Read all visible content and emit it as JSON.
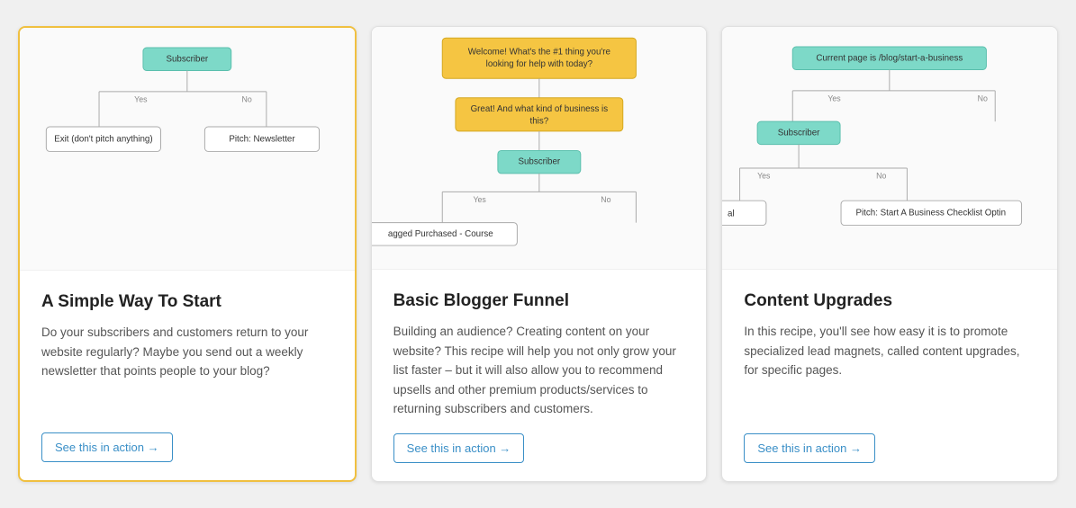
{
  "cards": [
    {
      "id": "card-1",
      "selected": true,
      "title": "A Simple Way To Start",
      "description": "Do your subscribers and customers return to your website regularly? Maybe you send out a weekly newsletter that points people to your blog?",
      "button_label": "See this in action →",
      "diagram_type": "simple_start"
    },
    {
      "id": "card-2",
      "selected": false,
      "title": "Basic Blogger Funnel",
      "description": "Building an audience? Creating content on your website? This recipe will help you not only grow your list faster – but it will also allow you to recommend upsells and other premium products/services to returning subscribers and customers.",
      "button_label": "See this in action →",
      "diagram_type": "blogger_funnel"
    },
    {
      "id": "card-3",
      "selected": false,
      "title": "Content Upgrades",
      "description": "In this recipe, you'll see how easy it is to promote specialized lead magnets, called content upgrades, for specific pages.",
      "button_label": "See this in action →",
      "diagram_type": "content_upgrades"
    }
  ]
}
